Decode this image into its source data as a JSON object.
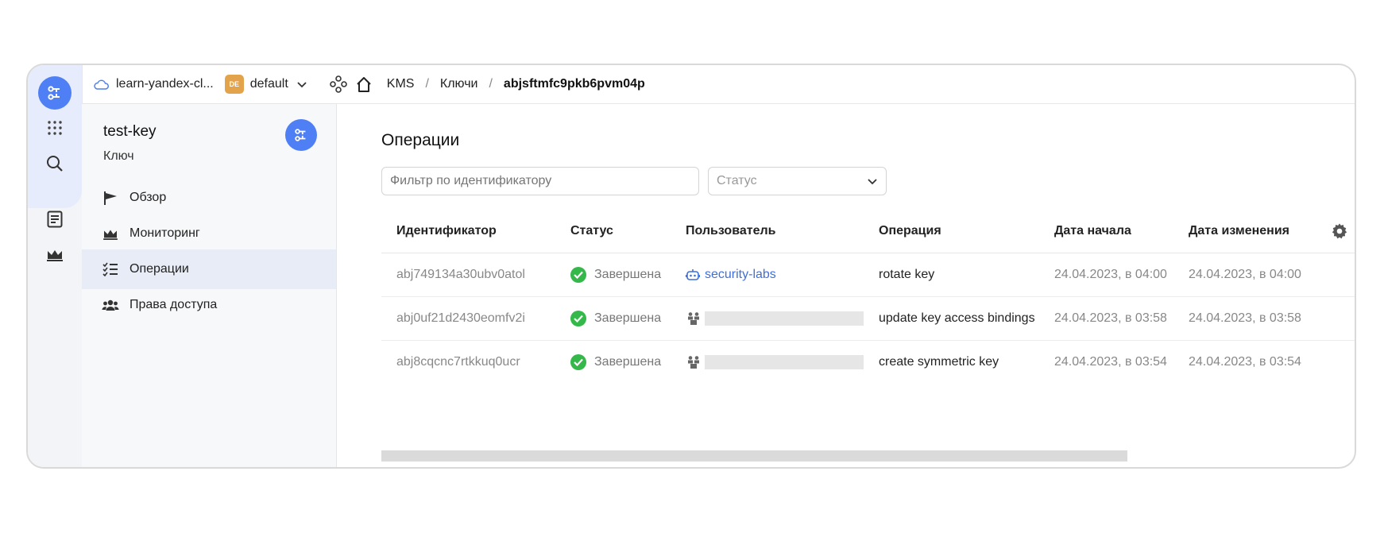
{
  "topbar": {
    "cloud_name": "learn-yandex-cl...",
    "folder_badge": "DE",
    "folder_name": "default",
    "breadcrumbs": [
      "KMS",
      "Ключи"
    ],
    "current": "abjsftmfc9pkb6pvm04p"
  },
  "sidebar": {
    "title": "test-key",
    "subtitle": "Ключ",
    "items": [
      {
        "label": "Обзор",
        "icon": "flag-icon"
      },
      {
        "label": "Мониторинг",
        "icon": "monitoring-icon"
      },
      {
        "label": "Операции",
        "icon": "operations-list-icon",
        "active": true
      },
      {
        "label": "Права доступа",
        "icon": "users-icon"
      }
    ]
  },
  "main": {
    "title": "Операции",
    "filter_placeholder": "Фильтр по идентификатору",
    "status_placeholder": "Статус",
    "columns": [
      "Идентификатор",
      "Статус",
      "Пользователь",
      "Операция",
      "Дата начала",
      "Дата изменения"
    ],
    "rows": [
      {
        "id": "abj749134a30ubv0atol",
        "status": "Завершена",
        "user": "security-labs",
        "operation": "rotate key",
        "start": "24.04.2023, в 04:00",
        "modified": "24.04.2023, в 04:00"
      },
      {
        "id": "abj0uf21d2430eomfv2i",
        "status": "Завершена",
        "user": "",
        "operation": "update key access bindings",
        "start": "24.04.2023, в 03:58",
        "modified": "24.04.2023, в 03:58"
      },
      {
        "id": "abj8cqcnc7rtkkuq0ucr",
        "status": "Завершена",
        "user": "",
        "operation": "create symmetric key",
        "start": "24.04.2023, в 03:54",
        "modified": "24.04.2023, в 03:54"
      }
    ]
  },
  "colors": {
    "accent": "#4f7ff4",
    "success": "#34b84a",
    "link": "#3f6fd8",
    "folder_badge": "#e3a34a"
  }
}
